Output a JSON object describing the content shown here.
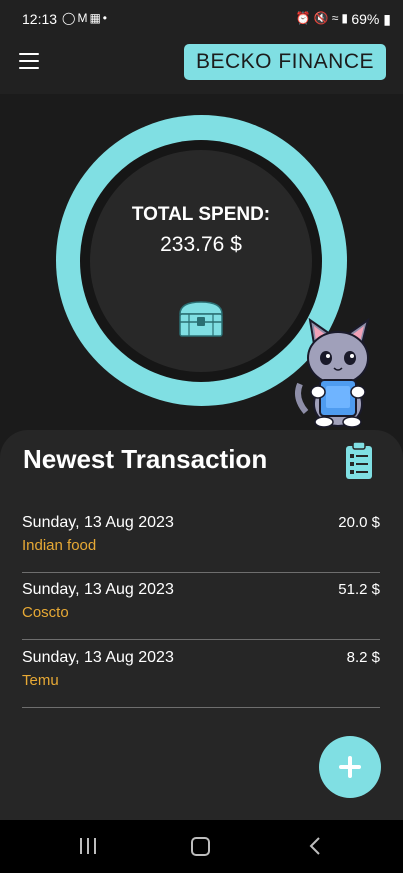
{
  "status_bar": {
    "time": "12:13",
    "battery": "69%",
    "left_icons": [
      "whatsapp-icon",
      "gmail-icon",
      "photo-icon",
      "dot-icon"
    ],
    "right_icons": [
      "alarm-icon",
      "mute-icon",
      "wifi-icon",
      "signal-icon",
      "battery-icon"
    ]
  },
  "app_bar": {
    "brand": "BECKO FINANCE",
    "menu_icon": "hamburger-menu-icon"
  },
  "summary": {
    "label": "TOTAL SPEND:",
    "value": "233.76 $",
    "icon": "treasure-chest-icon",
    "mascot": "cat-with-phone-illustration"
  },
  "transactions": {
    "title": "Newest Transaction",
    "icon": "clipboard-list-icon",
    "items": [
      {
        "date": "Sunday, 13 Aug 2023",
        "name": "Indian food",
        "amount": "20.0 $"
      },
      {
        "date": "Sunday, 13 Aug 2023",
        "name": "Coscto",
        "amount": "51.2 $"
      },
      {
        "date": "Sunday, 13 Aug 2023",
        "name": "Temu",
        "amount": "8.2 $"
      }
    ]
  },
  "fab": {
    "icon": "plus-icon"
  },
  "nav_bar": {
    "icons": [
      "recents-icon",
      "home-icon",
      "back-icon"
    ]
  },
  "colors": {
    "accent": "#80dfe3",
    "background": "#1b1b1b",
    "panel": "#262626",
    "transaction_name": "#e7a935"
  }
}
